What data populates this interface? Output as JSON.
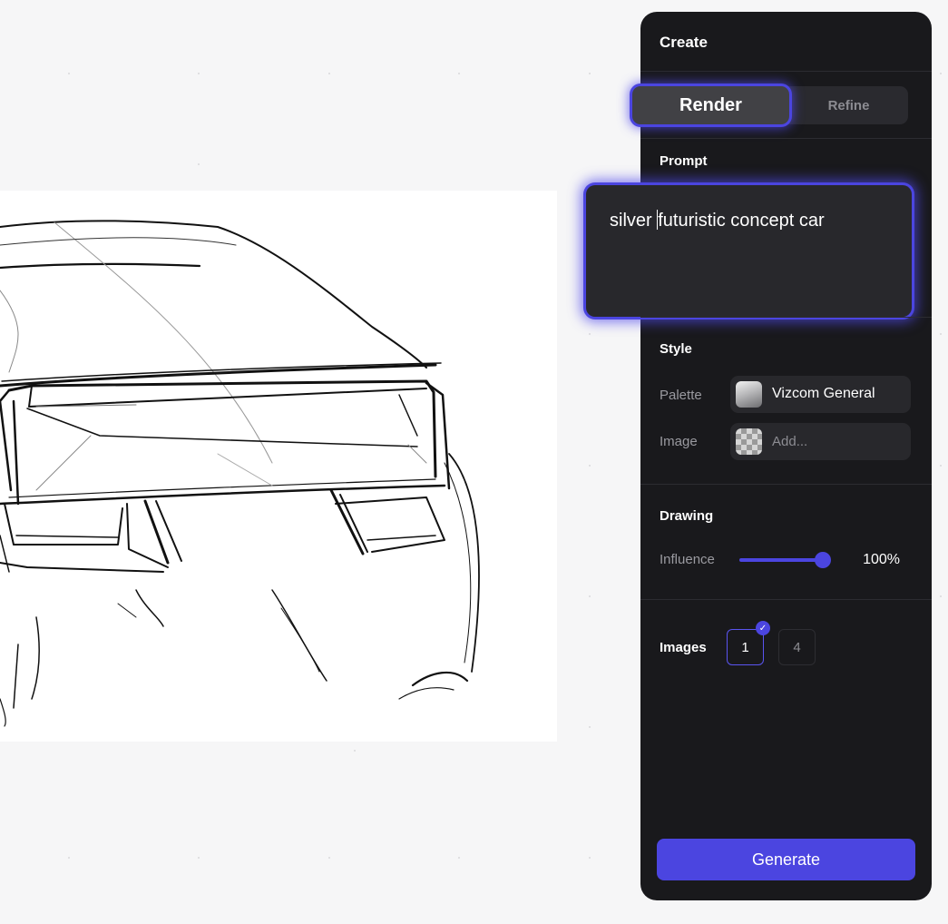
{
  "panel": {
    "title": "Create",
    "mode_tabs": [
      {
        "label": "Render",
        "active": true
      },
      {
        "label": "Refine",
        "active": false
      }
    ],
    "prompt": {
      "label": "Prompt",
      "text_before_caret": "silver ",
      "text_after_caret": "futuristic concept car"
    },
    "style": {
      "label": "Style",
      "palette": {
        "label": "Palette",
        "value": "Vizcom General",
        "icon": "palette-thumbnail-icon"
      },
      "image": {
        "label": "Image",
        "placeholder": "Add...",
        "icon": "transparent-checker-icon"
      }
    },
    "drawing": {
      "label": "Drawing",
      "influence": {
        "label": "Influence",
        "value_text": "100%",
        "value": 1.0
      }
    },
    "images": {
      "label": "Images",
      "options": [
        {
          "label": "1",
          "selected": true
        },
        {
          "label": "4",
          "selected": false
        }
      ]
    },
    "generate_label": "Generate"
  },
  "colors": {
    "accent": "#4b45e0",
    "panel_bg": "#19191c",
    "field_bg": "#28282c",
    "canvas_bg": "#f6f6f7"
  }
}
